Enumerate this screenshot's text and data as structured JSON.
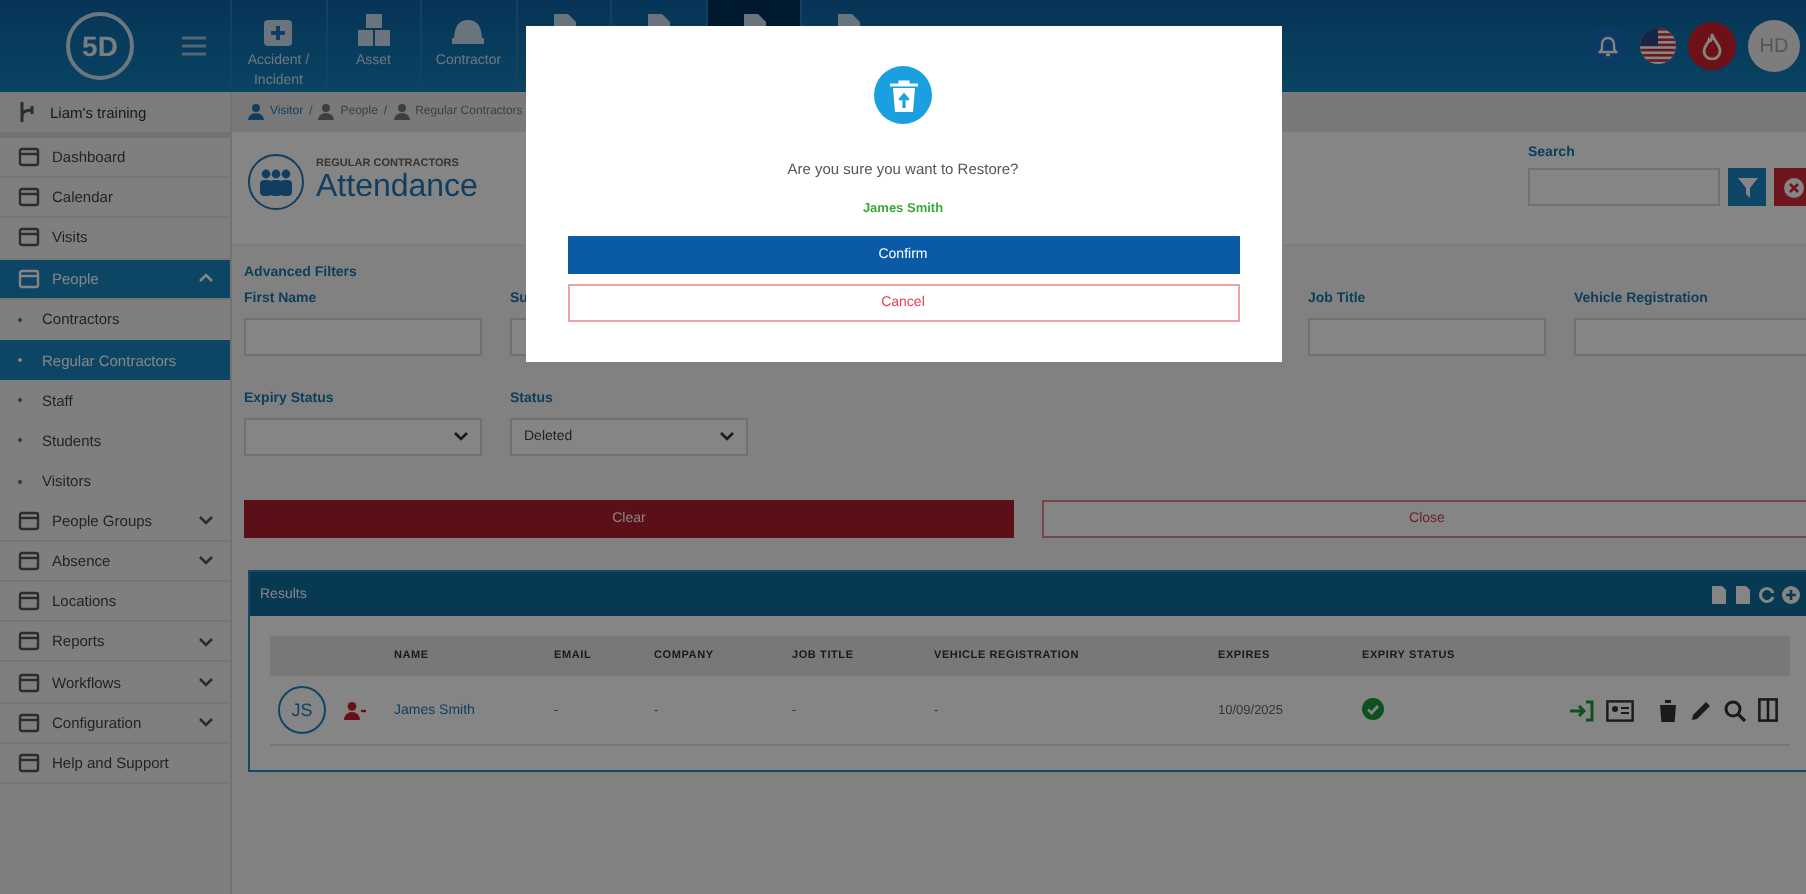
{
  "header": {
    "logo": "5D",
    "nav_tiles": [
      {
        "label": "Accident / Incident",
        "selected": false
      },
      {
        "label": "Asset",
        "selected": false
      },
      {
        "label": "Contractor",
        "selected": false
      },
      {
        "selected": false
      },
      {
        "selected": false
      },
      {
        "selected": true
      },
      {
        "selected": false
      }
    ],
    "avatar": "HD"
  },
  "sidebar": {
    "workspace": "Liam's training",
    "items": [
      {
        "label": "Dashboard",
        "kind": "item",
        "selected": false
      },
      {
        "label": "Calendar",
        "kind": "item",
        "selected": false
      },
      {
        "label": "Visits",
        "kind": "item",
        "selected": false
      },
      {
        "label": "People",
        "kind": "group",
        "selected": true,
        "expanded": true
      },
      {
        "label": "Contractors",
        "kind": "sub",
        "selected": false
      },
      {
        "label": "Regular Contractors",
        "kind": "sub",
        "selected": true
      },
      {
        "label": "Staff",
        "kind": "sub",
        "selected": false
      },
      {
        "label": "Students",
        "kind": "sub",
        "selected": false
      },
      {
        "label": "Visitors",
        "kind": "sub",
        "selected": false
      },
      {
        "label": "People Groups",
        "kind": "group",
        "selected": false,
        "expanded": false
      },
      {
        "label": "Absence",
        "kind": "group",
        "selected": false,
        "expanded": false
      },
      {
        "label": "Locations",
        "kind": "item",
        "selected": false
      },
      {
        "label": "Reports",
        "kind": "group",
        "selected": false,
        "expanded": false
      },
      {
        "label": "Workflows",
        "kind": "group",
        "selected": false,
        "expanded": false
      },
      {
        "label": "Configuration",
        "kind": "group",
        "selected": false,
        "expanded": false
      },
      {
        "label": "Help and Support",
        "kind": "item",
        "selected": false
      }
    ]
  },
  "breadcrumb": {
    "separator": "/",
    "items": [
      "Visitor",
      "People",
      "Regular Contractors"
    ]
  },
  "page": {
    "overline": "REGULAR CONTRACTORS",
    "title": "Attendance",
    "search_label": "Search"
  },
  "filters": {
    "title": "Advanced Filters",
    "fields": [
      {
        "label": "First Name",
        "kind": "text"
      },
      {
        "label": "Su",
        "kind": "text"
      },
      {
        "kind": "hidden"
      },
      {
        "kind": "hidden"
      },
      {
        "label": "Job Title",
        "kind": "text"
      },
      {
        "label": "Vehicle Registration",
        "kind": "text"
      },
      {
        "label": "Expiry Status",
        "kind": "select"
      },
      {
        "label": "Status",
        "kind": "select",
        "value": "Deleted"
      }
    ],
    "clear": "Clear",
    "close": "Close"
  },
  "results": {
    "title": "Results",
    "columns": [
      "NAME",
      "EMAIL",
      "COMPANY",
      "JOB TITLE",
      "VEHICLE REGISTRATION",
      "EXPIRES",
      "EXPIRY STATUS"
    ],
    "rows": [
      {
        "initials": "JS",
        "name": "James Smith",
        "email": "-",
        "company": "-",
        "job_title": "-",
        "vehicle_registration": "-",
        "expires": "10/09/2025",
        "valid": true
      }
    ]
  },
  "dialog": {
    "message": "Are you sure you want to Restore?",
    "name": "James Smith",
    "confirm": "Confirm",
    "cancel": "Cancel"
  }
}
